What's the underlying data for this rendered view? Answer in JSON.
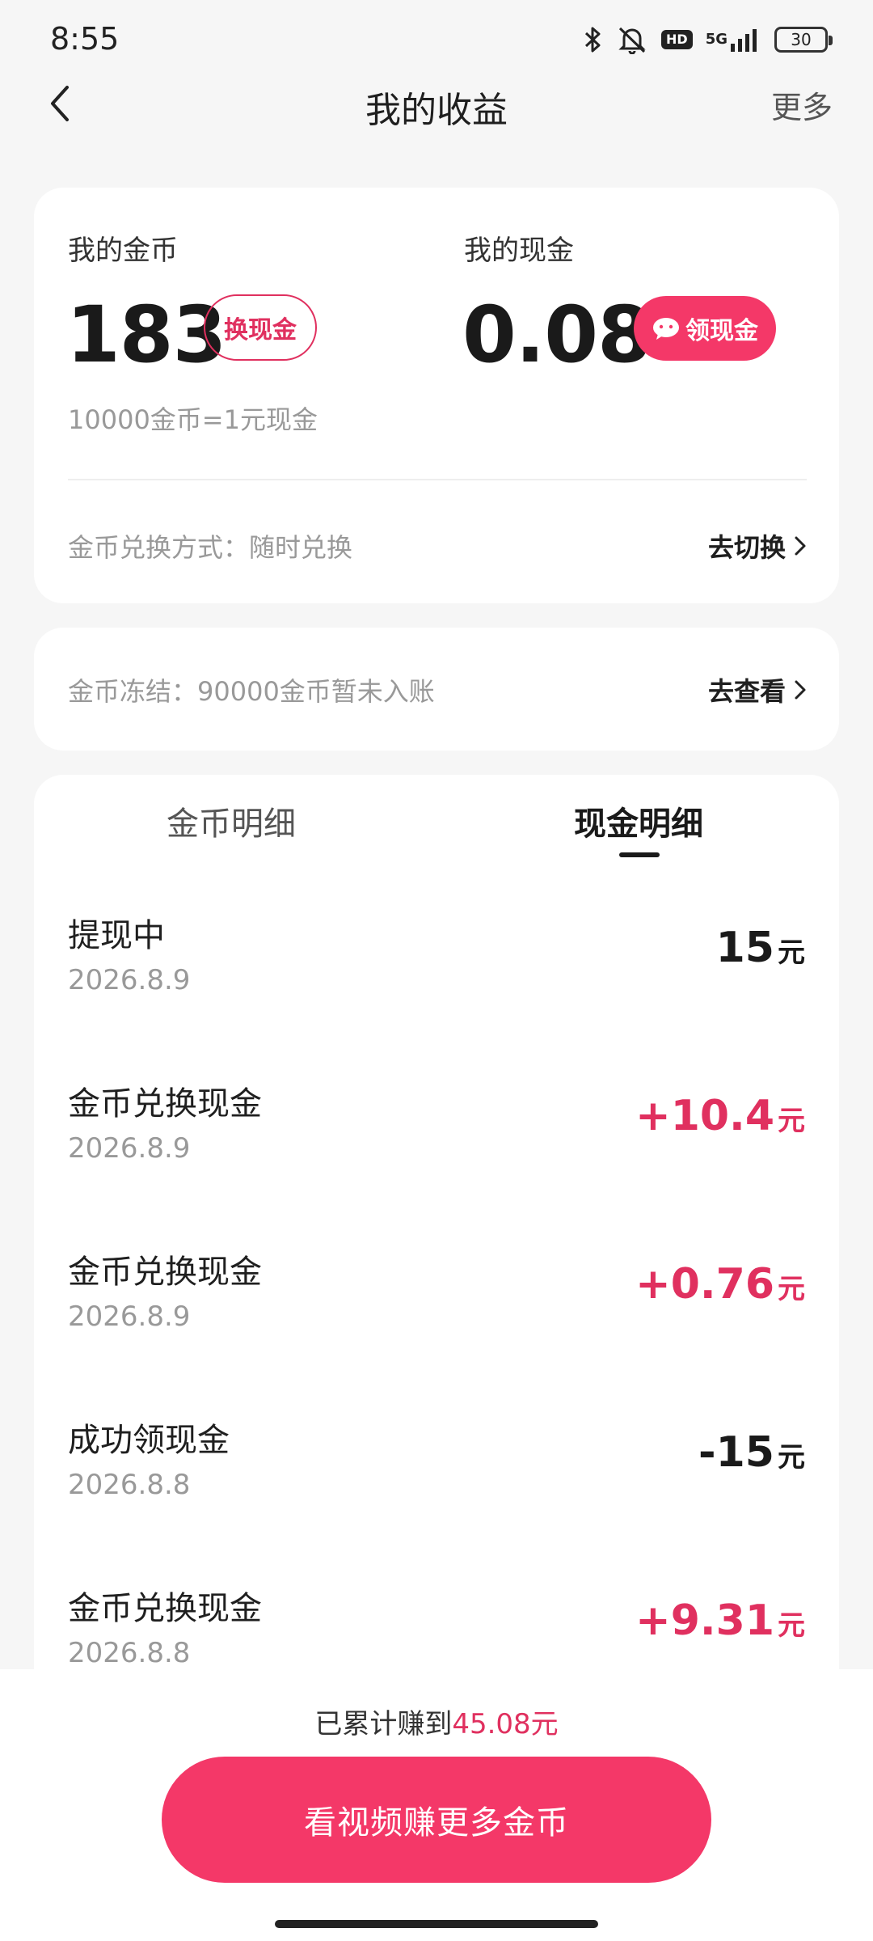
{
  "status_bar": {
    "time": "8:55",
    "hd": "HD",
    "network": "5G",
    "battery": "30"
  },
  "header": {
    "title": "我的收益",
    "more": "更多"
  },
  "balance": {
    "coin_label": "我的金币",
    "coin_value": "183",
    "exchange_label": "换现金",
    "cash_label": "我的现金",
    "cash_value": "0.08",
    "withdraw_label": "领现金",
    "rate_note": "10000金币=1元现金",
    "exchange_mode": "金币兑换方式：随时兑换",
    "switch_label": "去切换"
  },
  "frozen": {
    "text": "金币冻结：90000金币暂未入账",
    "view_label": "去查看"
  },
  "tabs": {
    "coin_detail": "金币明细",
    "cash_detail": "现金明细"
  },
  "records": [
    {
      "title": "提现中",
      "date": "2026.8.9",
      "amount": "15",
      "unit": "元"
    },
    {
      "title": "金币兑换现金",
      "date": "2026.8.9",
      "amount": "+10.4",
      "unit": "元"
    },
    {
      "title": "金币兑换现金",
      "date": "2026.8.9",
      "amount": "+0.76",
      "unit": "元"
    },
    {
      "title": "成功领现金",
      "date": "2026.8.8",
      "amount": "-15",
      "unit": "元"
    },
    {
      "title": "金币兑换现金",
      "date": "2026.8.8",
      "amount": "+9.31",
      "unit": "元"
    }
  ],
  "footer": {
    "total_prefix": "已累计赚到",
    "total_value": "45.08元",
    "cta_label": "看视频赚更多金币"
  },
  "colors": {
    "accent": "#f43868",
    "accent_text": "#e0305f",
    "background": "#f6f6f6"
  }
}
